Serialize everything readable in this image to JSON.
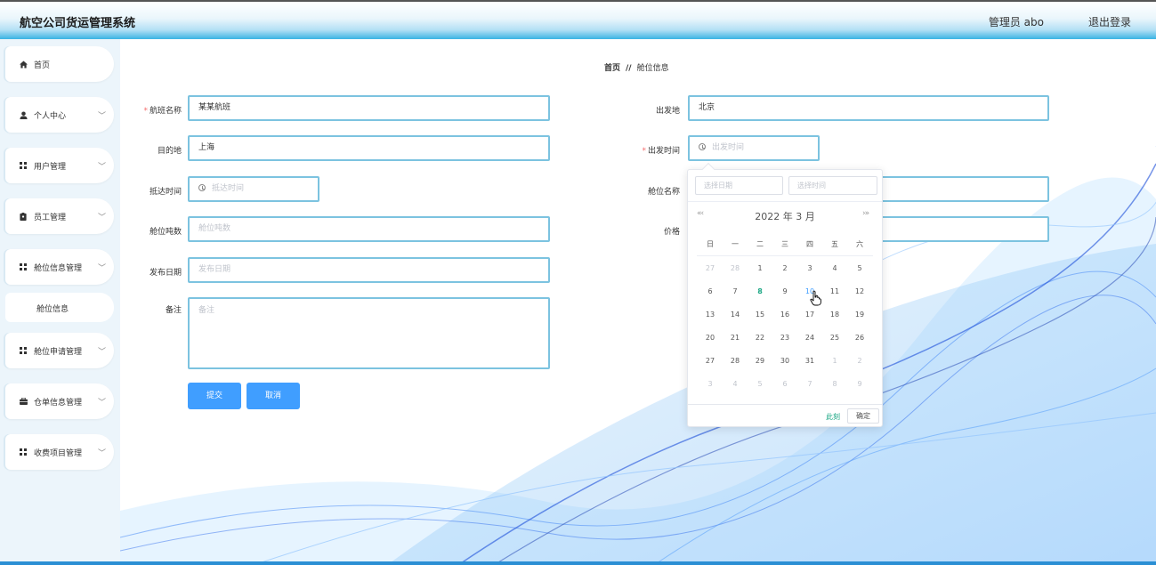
{
  "header": {
    "title": "航空公司货运管理系统",
    "admin": "管理员 abo",
    "logout": "退出登录"
  },
  "sidebar": {
    "items": [
      {
        "label": "首页",
        "icon": "home-icon",
        "chevron": ""
      },
      {
        "label": "个人中心",
        "icon": "user-icon",
        "chevron": "﹀"
      },
      {
        "label": "用户管理",
        "icon": "grid-icon",
        "chevron": "﹀"
      },
      {
        "label": "员工管理",
        "icon": "badge-icon",
        "chevron": "﹀"
      },
      {
        "label": "舱位信息管理",
        "icon": "grid-icon",
        "chevron": "﹀"
      },
      {
        "label": "舱位申请管理",
        "icon": "grid-icon",
        "chevron": "﹀"
      },
      {
        "label": "仓单信息管理",
        "icon": "briefcase-icon",
        "chevron": "﹀"
      },
      {
        "label": "收费项目管理",
        "icon": "grid-icon",
        "chevron": "﹀"
      }
    ],
    "subitem": "舱位信息"
  },
  "breadcrumb": {
    "home": "首页",
    "sep": "//",
    "current": "舱位信息"
  },
  "form": {
    "flight_name": {
      "label": "航班名称",
      "required": "*",
      "value": "某某航班"
    },
    "origin": {
      "label": "出发地",
      "value": "北京"
    },
    "destination": {
      "label": "目的地",
      "value": "上海"
    },
    "depart_time": {
      "label": "出发时间",
      "required": "*",
      "placeholder": "出发时间"
    },
    "arrive_time": {
      "label": "抵达时间",
      "placeholder": "抵达时间"
    },
    "cabin_name": {
      "label": "舱位名称",
      "placeholder": ""
    },
    "cabin_tons": {
      "label": "舱位吨数",
      "placeholder": "舱位吨数"
    },
    "price": {
      "label": "价格",
      "placeholder": ""
    },
    "publish_date": {
      "label": "发布日期",
      "placeholder": "发布日期"
    },
    "remark": {
      "label": "备注",
      "placeholder": "备注"
    },
    "submit": "提交",
    "cancel": "取消"
  },
  "datepicker": {
    "date_placeholder": "选择日期",
    "time_placeholder": "选择时间",
    "prev": "«‹",
    "next": "›»",
    "title": "2022 年  3 月",
    "weekdays": [
      "日",
      "一",
      "二",
      "三",
      "四",
      "五",
      "六"
    ],
    "days": [
      [
        "27",
        "28",
        "1",
        "2",
        "3",
        "4",
        "5"
      ],
      [
        "6",
        "7",
        "8",
        "9",
        "10",
        "11",
        "12"
      ],
      [
        "13",
        "14",
        "15",
        "16",
        "17",
        "18",
        "19"
      ],
      [
        "20",
        "21",
        "22",
        "23",
        "24",
        "25",
        "26"
      ],
      [
        "27",
        "28",
        "29",
        "30",
        "31",
        "1",
        "2"
      ],
      [
        "3",
        "4",
        "5",
        "6",
        "7",
        "8",
        "9"
      ]
    ],
    "today": "8",
    "hovered": "10",
    "now": "此刻",
    "ok": "确定"
  },
  "colors": {
    "accent": "#409eff",
    "required": "#f56c6c",
    "today": "#1ba784",
    "border": "#7cc3e0"
  }
}
